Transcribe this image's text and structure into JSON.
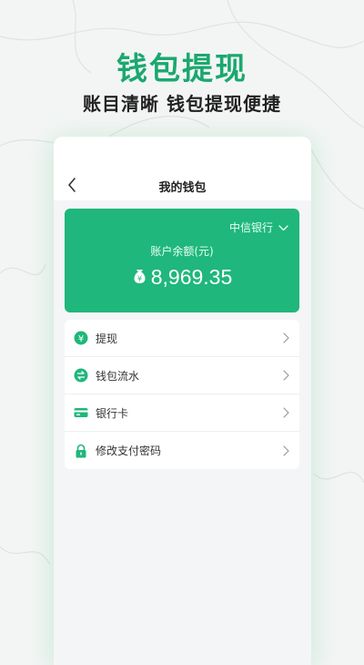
{
  "colors": {
    "accent": "#1fb77b",
    "accent_dark": "#18a56d",
    "headline": "#1ba86f"
  },
  "promo": {
    "headline": "钱包提现",
    "subline": "账目清晰 钱包提现便捷"
  },
  "app": {
    "title": "我的钱包",
    "balance_card": {
      "bank": "中信银行",
      "label": "账户余额(元)",
      "amount": "8,969.35"
    },
    "menu": [
      {
        "label": "提现",
        "icon": "yen-coin-icon"
      },
      {
        "label": "钱包流水",
        "icon": "transfer-icon"
      },
      {
        "label": "银行卡",
        "icon": "bank-card-icon"
      },
      {
        "label": "修改支付密码",
        "icon": "lock-icon"
      }
    ]
  }
}
